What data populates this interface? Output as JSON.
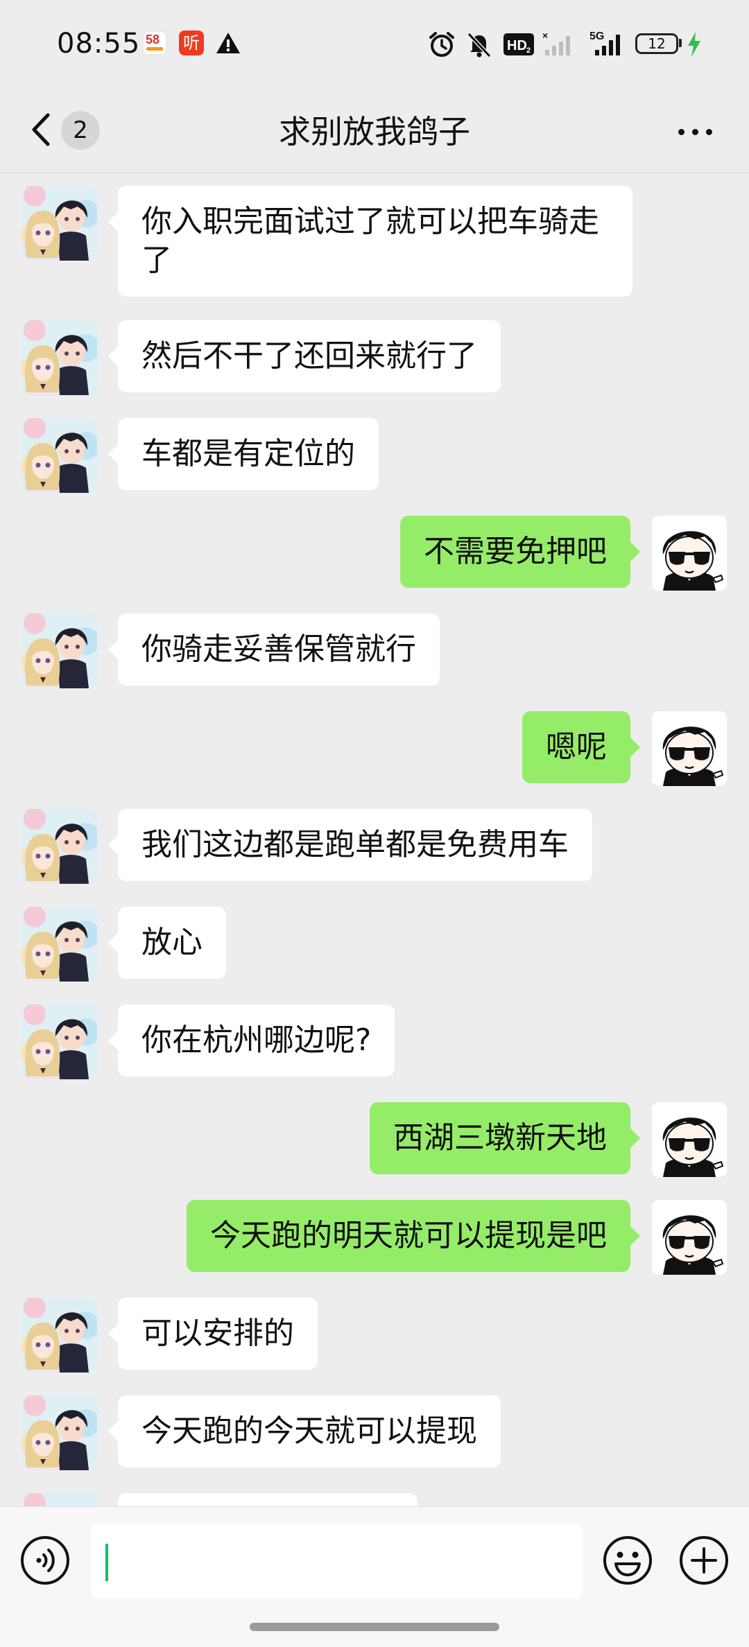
{
  "status_bar": {
    "time": "08:55",
    "app_58_label": "58",
    "app_ting_label": "听",
    "network_label": "5G",
    "hd_label": "HD",
    "battery_level": "12"
  },
  "nav": {
    "unread_count": "2",
    "title": "求别放我鸽子"
  },
  "messages": [
    {
      "side": "in",
      "text": "你入职完面试过了就可以把车骑走了"
    },
    {
      "side": "in",
      "text": "然后不干了还回来就行了"
    },
    {
      "side": "in",
      "text": "车都是有定位的"
    },
    {
      "side": "out",
      "text": "不需要免押吧"
    },
    {
      "side": "in",
      "text": "你骑走妥善保管就行"
    },
    {
      "side": "out",
      "text": "嗯呢"
    },
    {
      "side": "in",
      "text": "我们这边都是跑单都是免费用车"
    },
    {
      "side": "in",
      "text": "放心"
    },
    {
      "side": "in",
      "text": "你在杭州哪边呢?"
    },
    {
      "side": "out",
      "text": "西湖三墩新天地"
    },
    {
      "side": "out",
      "text": "今天跑的明天就可以提现是吧"
    },
    {
      "side": "in",
      "text": "可以安排的"
    },
    {
      "side": "in",
      "text": "今天跑的今天就可以提现"
    }
  ],
  "input": {
    "value": "",
    "placeholder": ""
  },
  "icons": {
    "back": "chevron-left-icon",
    "more": "more-dots-icon",
    "voice": "voice-icon",
    "emoji": "emoji-icon",
    "plus": "plus-icon"
  },
  "colors": {
    "background": "#ededed",
    "incoming_bubble": "#ffffff",
    "outgoing_bubble": "#95ec69",
    "caret": "#07c160"
  }
}
